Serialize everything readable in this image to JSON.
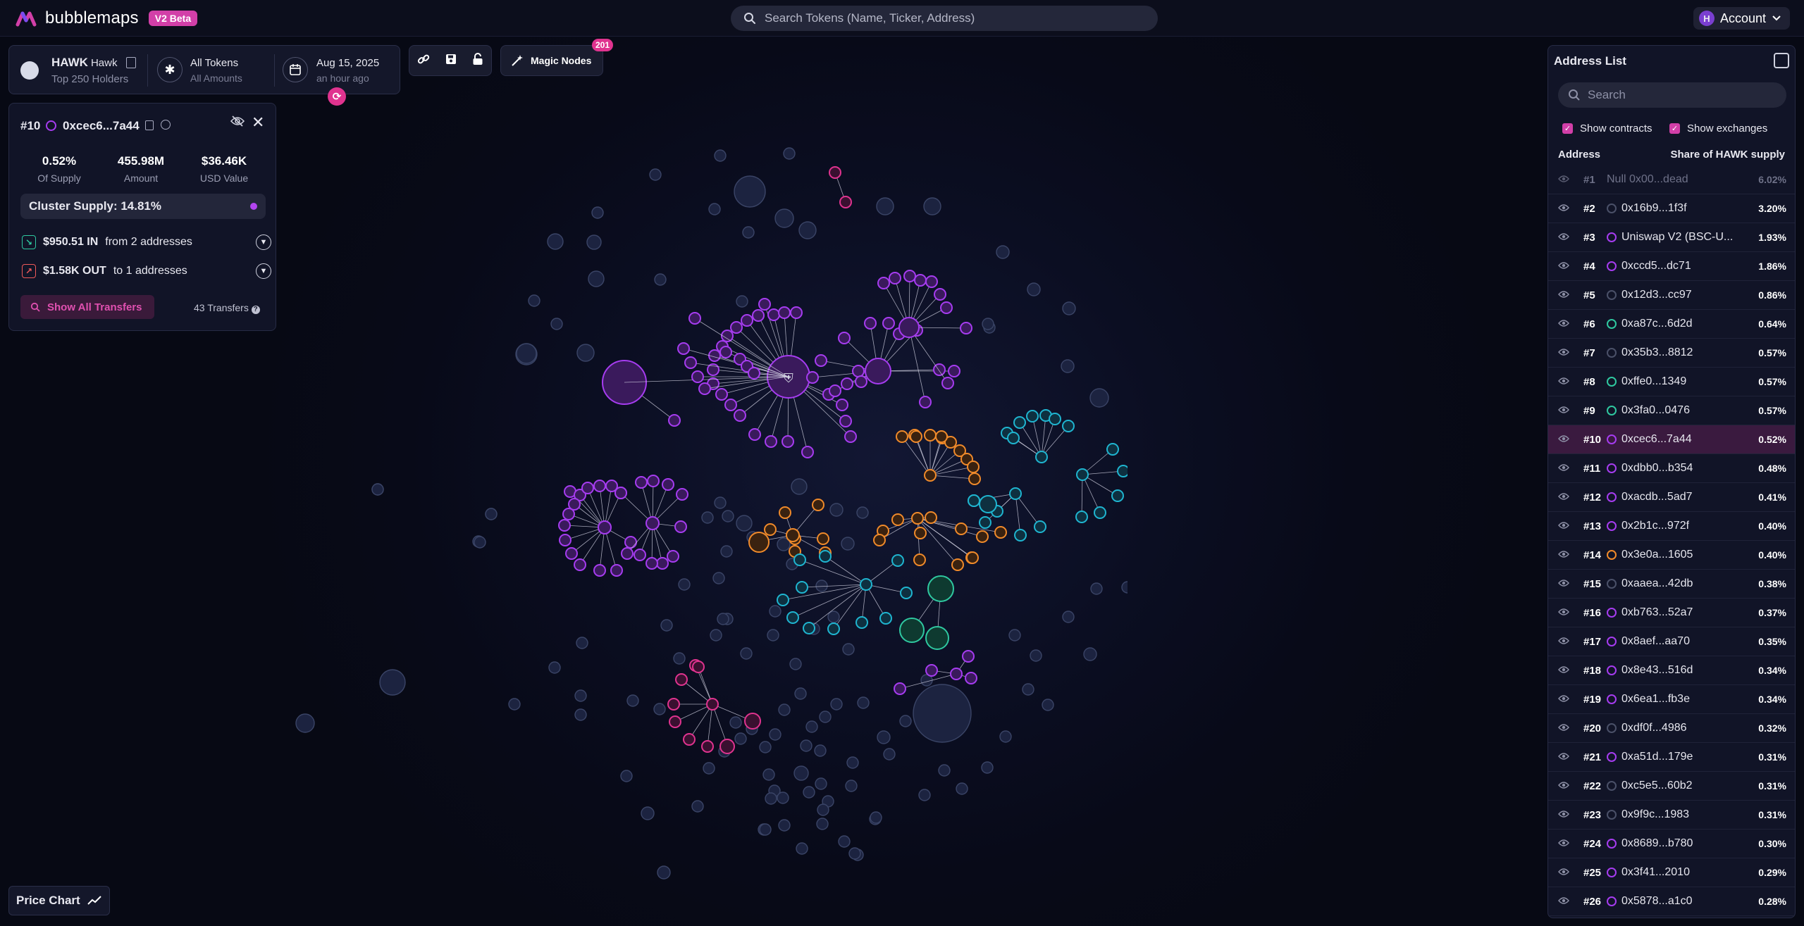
{
  "app": {
    "name": "bubblemaps",
    "badge": "V2 Beta",
    "search_placeholder": "Search Tokens (Name, Ticker, Address)",
    "account_initial": "H",
    "account_label": "Account"
  },
  "token": {
    "symbol": "HAWK",
    "name": "Hawk",
    "holders_label": "Top 250 Holders",
    "filter_label": "All Tokens",
    "filter_sub": "All Amounts",
    "date": "Aug 15, 2025",
    "date_sub": "an hour ago"
  },
  "toolbar": {
    "magic_label": "Magic Nodes",
    "magic_count": "201"
  },
  "selected": {
    "rank": "#10",
    "address": "0xcec6...7a44",
    "stats": [
      {
        "value": "0.52%",
        "label": "Of Supply"
      },
      {
        "value": "455.98M",
        "label": "Amount"
      },
      {
        "value": "$36.46K",
        "label": "USD Value"
      }
    ],
    "cluster_supply": "Cluster Supply: 14.81%",
    "inflow_amount": "$950.51 IN",
    "inflow_text": "from 2 addresses",
    "outflow_amount": "$1.58K OUT",
    "outflow_text": "to 1 addresses",
    "show_all": "Show All Transfers",
    "transfers_count": "43 Transfers"
  },
  "address_list": {
    "title": "Address List",
    "search_placeholder": "Search",
    "show_contracts": "Show contracts",
    "show_exchanges": "Show exchanges",
    "col_address": "Address",
    "col_share": "Share of HAWK supply",
    "rows": [
      {
        "rank": "#1",
        "address": "Null 0x00...dead",
        "share": "6.02%",
        "ring": "none",
        "dim": true
      },
      {
        "rank": "#2",
        "address": "0x16b9...1f3f",
        "share": "3.20%",
        "ring": "#4a5068"
      },
      {
        "rank": "#3",
        "address": "Uniswap V2 (BSC-U...",
        "share": "1.93%",
        "ring": "#a63cf0"
      },
      {
        "rank": "#4",
        "address": "0xccd5...dc71",
        "share": "1.86%",
        "ring": "#a63cf0"
      },
      {
        "rank": "#5",
        "address": "0x12d3...cc97",
        "share": "0.86%",
        "ring": "#4a5068"
      },
      {
        "rank": "#6",
        "address": "0xa87c...6d2d",
        "share": "0.64%",
        "ring": "#2fc8a0"
      },
      {
        "rank": "#7",
        "address": "0x35b3...8812",
        "share": "0.57%",
        "ring": "#4a5068"
      },
      {
        "rank": "#8",
        "address": "0xffe0...1349",
        "share": "0.57%",
        "ring": "#2fc8a0"
      },
      {
        "rank": "#9",
        "address": "0x3fa0...0476",
        "share": "0.57%",
        "ring": "#2fc8a0"
      },
      {
        "rank": "#10",
        "address": "0xcec6...7a44",
        "share": "0.52%",
        "ring": "#a63cf0",
        "selected": true
      },
      {
        "rank": "#11",
        "address": "0xdbb0...b354",
        "share": "0.48%",
        "ring": "#a63cf0"
      },
      {
        "rank": "#12",
        "address": "0xacdb...5ad7",
        "share": "0.41%",
        "ring": "#a63cf0"
      },
      {
        "rank": "#13",
        "address": "0x2b1c...972f",
        "share": "0.40%",
        "ring": "#a63cf0"
      },
      {
        "rank": "#14",
        "address": "0x3e0a...1605",
        "share": "0.40%",
        "ring": "#f08a2a"
      },
      {
        "rank": "#15",
        "address": "0xaaea...42db",
        "share": "0.38%",
        "ring": "#4a5068"
      },
      {
        "rank": "#16",
        "address": "0xb763...52a7",
        "share": "0.37%",
        "ring": "#a63cf0"
      },
      {
        "rank": "#17",
        "address": "0x8aef...aa70",
        "share": "0.35%",
        "ring": "#a63cf0"
      },
      {
        "rank": "#18",
        "address": "0x8e43...516d",
        "share": "0.34%",
        "ring": "#a63cf0"
      },
      {
        "rank": "#19",
        "address": "0x6ea1...fb3e",
        "share": "0.34%",
        "ring": "#a63cf0"
      },
      {
        "rank": "#20",
        "address": "0xdf0f...4986",
        "share": "0.32%",
        "ring": "#4a5068"
      },
      {
        "rank": "#21",
        "address": "0xa51d...179e",
        "share": "0.31%",
        "ring": "#a63cf0"
      },
      {
        "rank": "#22",
        "address": "0xc5e5...60b2",
        "share": "0.31%",
        "ring": "#4a5068"
      },
      {
        "rank": "#23",
        "address": "0x9f9c...1983",
        "share": "0.31%",
        "ring": "#4a5068"
      },
      {
        "rank": "#24",
        "address": "0x8689...b780",
        "share": "0.30%",
        "ring": "#a63cf0"
      },
      {
        "rank": "#25",
        "address": "0x3f41...2010",
        "share": "0.29%",
        "ring": "#a63cf0"
      },
      {
        "rank": "#26",
        "address": "0x5878...a1c0",
        "share": "0.28%",
        "ring": "#a63cf0"
      }
    ]
  },
  "price_chart_label": "Price Chart",
  "colors": {
    "accent": "#d23fa8",
    "purple": "#a63cf0",
    "orange": "#f08a2a",
    "cyan": "#1fb5d0",
    "teal": "#2fc8a0",
    "pink": "#e0338f",
    "grey_node": "#3a4466"
  }
}
